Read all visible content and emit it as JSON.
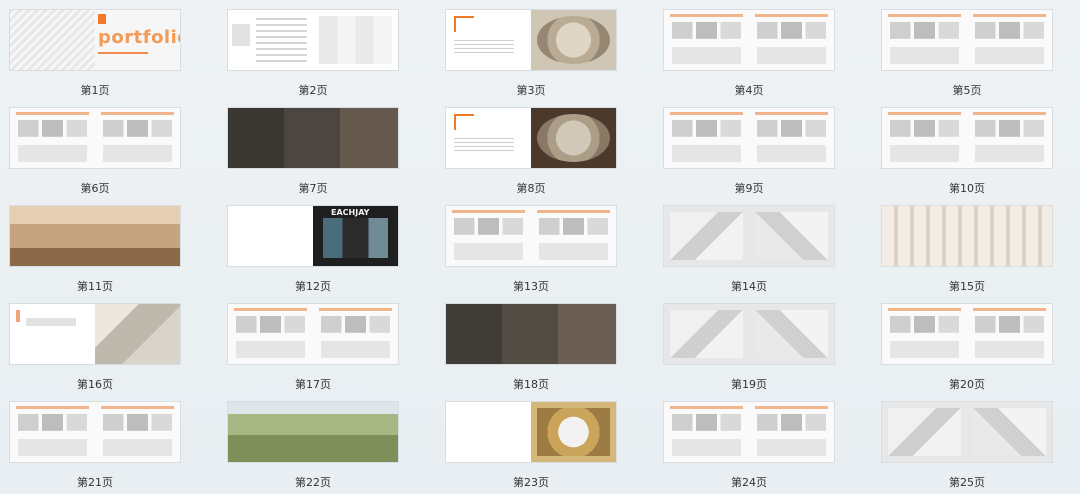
{
  "grid": {
    "labels": [
      "第1页",
      "第2页",
      "第3页",
      "第4页",
      "第5页",
      "第6页",
      "第7页",
      "第8页",
      "第9页",
      "第10页",
      "第11页",
      "第12页",
      "第13页",
      "第14页",
      "第15页",
      "第16页",
      "第17页",
      "第18页",
      "第19页",
      "第20页",
      "第21页",
      "第22页",
      "第23页",
      "第24页",
      "第25页"
    ]
  },
  "cover": {
    "title": "portfolio"
  },
  "store": {
    "brand": "EACHJAY"
  }
}
